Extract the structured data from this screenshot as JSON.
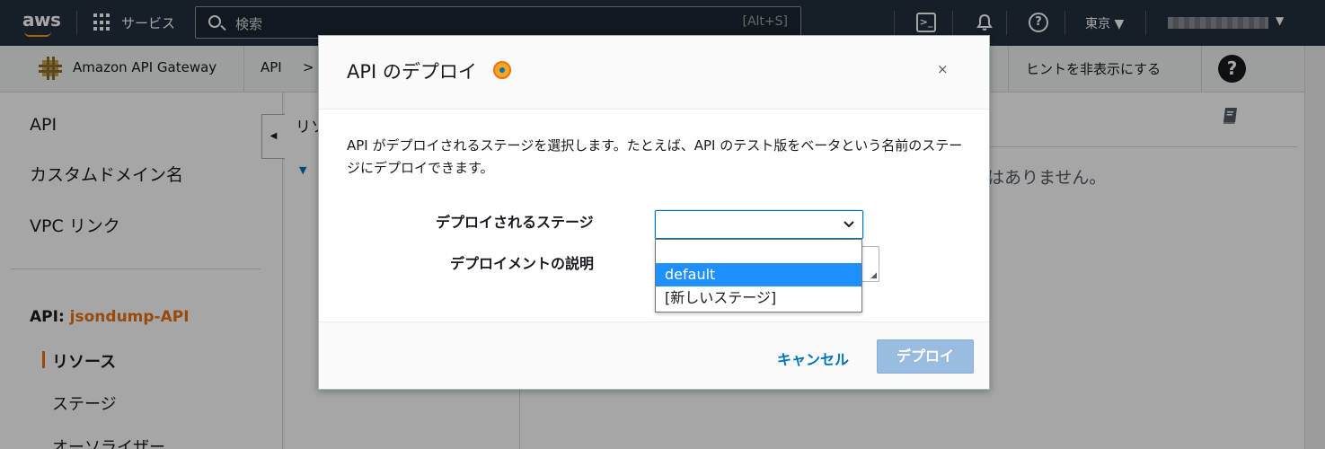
{
  "topnav": {
    "logo_text": "aws",
    "services_label": "サービス",
    "search_placeholder": "検索",
    "search_shortcut": "[Alt+S]",
    "region_label": "東京 ▼"
  },
  "subbar": {
    "service_name": "Amazon API Gateway",
    "breadcrumb_api": "API",
    "breadcrumb_sep": ">",
    "hint_label": "ヒントを非表示にする",
    "help_label": "?"
  },
  "sidebar": {
    "items": [
      "API",
      "カスタムドメイン名",
      "VPC リンク"
    ],
    "api_prefix": "API:",
    "api_name": "jsondump-API",
    "sub_items": [
      "リソース",
      "ステージ",
      "オーソライザー"
    ]
  },
  "resources": {
    "title": "リソ"
  },
  "main": {
    "empty_message": "はありません。"
  },
  "modal": {
    "title": "API のデプロイ",
    "description": "API がデプロイされるステージを選択します。たとえば、API のテスト版をベータという名前のステージにデプロイできます。",
    "stage_label": "デプロイされるステージ",
    "deployment_desc_label": "デプロイメントの説明",
    "stage_options": [
      "",
      "default",
      "[新しいステージ]"
    ],
    "highlighted_option": "default",
    "cancel_label": "キャンセル",
    "deploy_label": "デプロイ"
  },
  "colors": {
    "nav_bg": "#232f3e",
    "accent_orange": "#ec7211",
    "link_blue": "#0073bb",
    "option_highlight": "#1e90ff",
    "deploy_disabled": "#99bce0"
  }
}
